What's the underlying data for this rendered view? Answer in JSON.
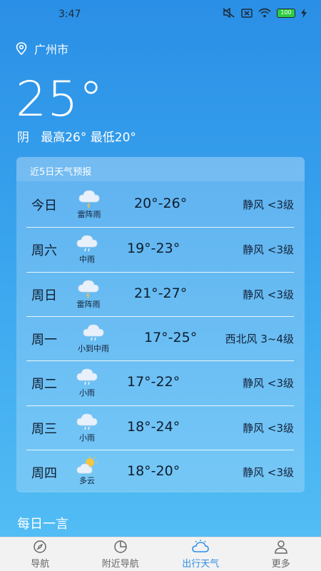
{
  "status_bar": {
    "time": "3:47",
    "battery": "100"
  },
  "location": {
    "city": "广州市"
  },
  "current": {
    "temperature": "25°",
    "summary": "阴   最高26° 最低20°"
  },
  "forecast": {
    "title": "近5日天气预报",
    "days": [
      {
        "name": "今日",
        "condition": "雷阵雨",
        "icon": "thunder-rain-icon",
        "temp": "20°-26°",
        "wind": "静风 <3级"
      },
      {
        "name": "周六",
        "condition": "中雨",
        "icon": "rain-icon",
        "temp": "19°-23°",
        "wind": "静风 <3级"
      },
      {
        "name": "周日",
        "condition": "雷阵雨",
        "icon": "thunder-rain-icon",
        "temp": "21°-27°",
        "wind": "静风 <3级"
      },
      {
        "name": "周一",
        "condition": "小到中雨",
        "icon": "rain-icon",
        "temp": "17°-25°",
        "wind": "西北风 3~4级"
      },
      {
        "name": "周二",
        "condition": "小雨",
        "icon": "rain-icon",
        "temp": "17°-22°",
        "wind": "静风 <3级"
      },
      {
        "name": "周三",
        "condition": "小雨",
        "icon": "rain-icon",
        "temp": "18°-24°",
        "wind": "静风 <3级"
      },
      {
        "name": "周四",
        "condition": "多云",
        "icon": "partly-cloudy-icon",
        "temp": "18°-20°",
        "wind": "静风 <3级"
      }
    ]
  },
  "quote": {
    "title": "每日一言"
  },
  "nav": {
    "items": [
      {
        "label": "导航",
        "icon": "compass-icon"
      },
      {
        "label": "附近导航",
        "icon": "pie-icon"
      },
      {
        "label": "出行天气",
        "icon": "weather-icon",
        "active": true
      },
      {
        "label": "更多",
        "icon": "user-icon"
      }
    ]
  },
  "colors": {
    "accent": "#2d8ee8",
    "text_dark": "#0f1c2e"
  }
}
